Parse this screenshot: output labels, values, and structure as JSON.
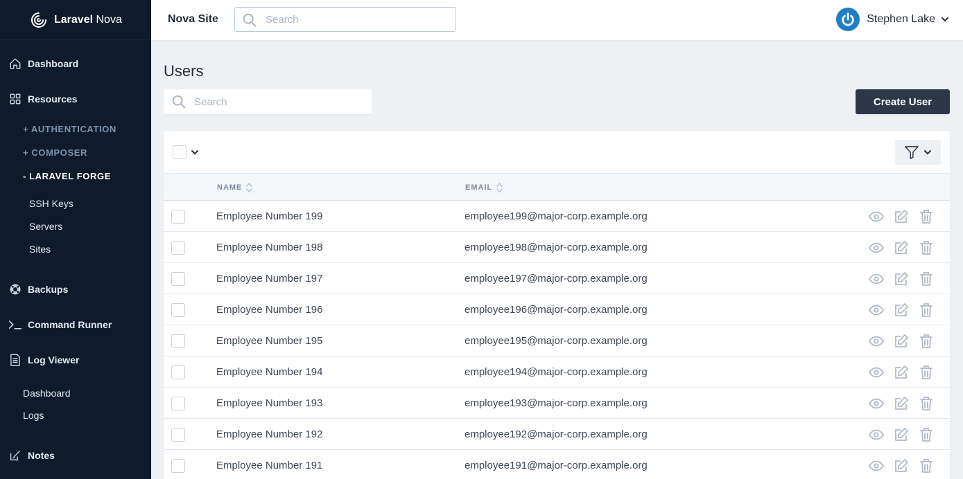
{
  "brand": {
    "name_bold": "Laravel",
    "name_rest": " Nova"
  },
  "sidebar": {
    "dashboard": "Dashboard",
    "resources": "Resources",
    "groups": [
      {
        "label": "+ AUTHENTICATION",
        "active": false
      },
      {
        "label": "+ COMPOSER",
        "active": false
      },
      {
        "label": "- LARAVEL FORGE",
        "active": true
      }
    ],
    "forge_items": [
      "SSH Keys",
      "Servers",
      "Sites"
    ],
    "backups": "Backups",
    "command_runner": "Command Runner",
    "log_viewer": "Log Viewer",
    "log_items": [
      "Dashboard",
      "Logs"
    ],
    "notes": "Notes"
  },
  "header": {
    "site_name": "Nova Site",
    "search_placeholder": "Search",
    "user_name": "Stephen Lake"
  },
  "main": {
    "title": "Users",
    "search_placeholder": "Search",
    "create_label": "Create User",
    "columns": {
      "name": "NAME",
      "email": "EMAIL"
    },
    "rows": [
      {
        "name": "Employee Number 199",
        "email": "employee199@major-corp.example.org"
      },
      {
        "name": "Employee Number 198",
        "email": "employee198@major-corp.example.org"
      },
      {
        "name": "Employee Number 197",
        "email": "employee197@major-corp.example.org"
      },
      {
        "name": "Employee Number 196",
        "email": "employee196@major-corp.example.org"
      },
      {
        "name": "Employee Number 195",
        "email": "employee195@major-corp.example.org"
      },
      {
        "name": "Employee Number 194",
        "email": "employee194@major-corp.example.org"
      },
      {
        "name": "Employee Number 193",
        "email": "employee193@major-corp.example.org"
      },
      {
        "name": "Employee Number 192",
        "email": "employee192@major-corp.example.org"
      },
      {
        "name": "Employee Number 191",
        "email": "employee191@major-corp.example.org"
      }
    ]
  },
  "icons": {
    "brand": "nova-logo-icon",
    "dashboard": "home-icon",
    "resources": "grid-icon",
    "backups": "lifebuoy-icon",
    "command_runner": "terminal-icon",
    "log_viewer": "document-icon",
    "notes": "edit-note-icon",
    "search": "search-icon",
    "filter": "filter-icon",
    "row_actions": [
      "eye-icon",
      "pencil-icon",
      "trash-icon"
    ]
  },
  "colors": {
    "sidebar_bg": "#0f1b2b",
    "primary_btn": "#2d3748",
    "avatar": "#1f7fc5",
    "page_bg": "#eef1f4"
  }
}
